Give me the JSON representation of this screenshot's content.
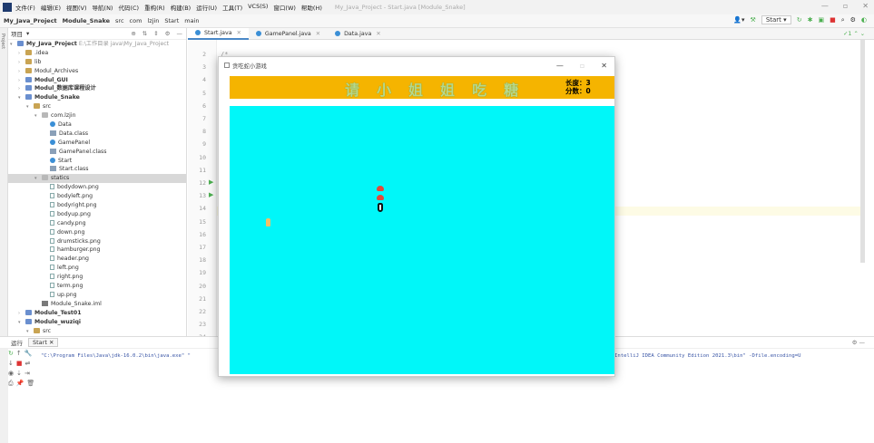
{
  "menubar": {
    "items": [
      "文件(F)",
      "编辑(E)",
      "视图(V)",
      "导航(N)",
      "代码(C)",
      "重构(R)",
      "构建(B)",
      "运行(U)",
      "工具(T)",
      "VCS(S)",
      "窗口(W)",
      "帮助(H)"
    ],
    "window_title": "My_Java_Project - Start.java [Module_Snake]"
  },
  "navbar": {
    "crumbs": [
      "My_Java_Project",
      "Module_Snake",
      "src",
      "com",
      "lzjin",
      "Start",
      "main"
    ]
  },
  "runbar": {
    "config": "Start"
  },
  "project": {
    "header": "项目",
    "tree": [
      {
        "label": "My_Java_Project",
        "extra": "E:\\工作目录 java\\My_Java_Project",
        "indent": 0,
        "arrow": "▾",
        "icon": "mod",
        "bold": true
      },
      {
        "label": ".idea",
        "indent": 1,
        "arrow": "›",
        "icon": "folder"
      },
      {
        "label": "lib",
        "indent": 1,
        "arrow": "›",
        "icon": "folder"
      },
      {
        "label": "Modul_Archives",
        "indent": 1,
        "arrow": "›",
        "icon": "folder"
      },
      {
        "label": "Modul_GUI",
        "indent": 1,
        "arrow": "›",
        "icon": "mod",
        "bold": true
      },
      {
        "label": "Modul_数据库课程设计",
        "indent": 1,
        "arrow": "›",
        "icon": "mod",
        "bold": true
      },
      {
        "label": "Module_Snake",
        "indent": 1,
        "arrow": "▾",
        "icon": "mod",
        "bold": true
      },
      {
        "label": "src",
        "indent": 2,
        "arrow": "▾",
        "icon": "folder"
      },
      {
        "label": "com.lzjin",
        "indent": 3,
        "arrow": "▾",
        "icon": "pkg"
      },
      {
        "label": "Data",
        "indent": 4,
        "arrow": "",
        "icon": "cls"
      },
      {
        "label": "Data.class",
        "indent": 4,
        "arrow": "",
        "icon": "clsf"
      },
      {
        "label": "GamePanel",
        "indent": 4,
        "arrow": "",
        "icon": "cls"
      },
      {
        "label": "GamePanel.class",
        "indent": 4,
        "arrow": "",
        "icon": "clsf"
      },
      {
        "label": "Start",
        "indent": 4,
        "arrow": "",
        "icon": "cls"
      },
      {
        "label": "Start.class",
        "indent": 4,
        "arrow": "",
        "icon": "clsf"
      },
      {
        "label": "statics",
        "indent": 3,
        "arrow": "▾",
        "icon": "pkg",
        "selected": true
      },
      {
        "label": "bodydown.png",
        "indent": 4,
        "arrow": "",
        "icon": "img"
      },
      {
        "label": "bodyleft.png",
        "indent": 4,
        "arrow": "",
        "icon": "img"
      },
      {
        "label": "bodyright.png",
        "indent": 4,
        "arrow": "",
        "icon": "img"
      },
      {
        "label": "bodyup.png",
        "indent": 4,
        "arrow": "",
        "icon": "img"
      },
      {
        "label": "candy.png",
        "indent": 4,
        "arrow": "",
        "icon": "img"
      },
      {
        "label": "down.png",
        "indent": 4,
        "arrow": "",
        "icon": "img"
      },
      {
        "label": "drumsticks.png",
        "indent": 4,
        "arrow": "",
        "icon": "img"
      },
      {
        "label": "hamburger.png",
        "indent": 4,
        "arrow": "",
        "icon": "img"
      },
      {
        "label": "header.png",
        "indent": 4,
        "arrow": "",
        "icon": "img"
      },
      {
        "label": "left.png",
        "indent": 4,
        "arrow": "",
        "icon": "img"
      },
      {
        "label": "right.png",
        "indent": 4,
        "arrow": "",
        "icon": "img"
      },
      {
        "label": "term.png",
        "indent": 4,
        "arrow": "",
        "icon": "img"
      },
      {
        "label": "up.png",
        "indent": 4,
        "arrow": "",
        "icon": "img"
      },
      {
        "label": "Module_Snake.iml",
        "indent": 3,
        "arrow": "",
        "icon": "iml"
      },
      {
        "label": "Module_Test01",
        "indent": 1,
        "arrow": "›",
        "icon": "mod",
        "bold": true
      },
      {
        "label": "Module_wuziqi",
        "indent": 1,
        "arrow": "▾",
        "icon": "mod",
        "bold": true
      },
      {
        "label": "src",
        "indent": 2,
        "arrow": "▾",
        "icon": "folder"
      }
    ]
  },
  "editor": {
    "tabs": [
      {
        "label": "Start.java",
        "active": true
      },
      {
        "label": "GamePanel.java",
        "active": false
      },
      {
        "label": "Data.java",
        "active": false
      }
    ],
    "line_numbers": [
      "2",
      "3",
      "4",
      "5",
      "6",
      "7",
      "8",
      "9",
      "10",
      "11",
      "12",
      "13",
      "14",
      "15",
      "16",
      "17",
      "18",
      "19",
      "20",
      "21",
      "22",
      "23",
      "24"
    ],
    "code_line1": "/*"
  },
  "run": {
    "header": "运行",
    "tab": "Start",
    "cmd": "\"C:\\Program Files\\Java\\jdk-16.0.2\\bin\\java.exe\" \"",
    "cmd_tail": "IntelliJ IDEA Community Edition 2021.3\\bin\" -Dfile.encoding=U"
  },
  "game": {
    "window_title": "贪吃蛇小游戏",
    "banner_chars": [
      "请",
      "小",
      "姐",
      "姐",
      "吃",
      "糖"
    ],
    "length_label": "长度：3",
    "score_label": "分数：0"
  },
  "colors": {
    "banner": "#f5b400",
    "field": "#00f7f9",
    "accent": "#4a88c7"
  }
}
